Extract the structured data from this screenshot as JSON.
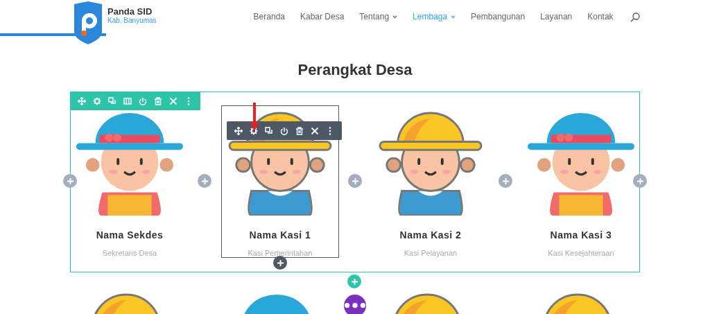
{
  "site": {
    "name": "Panda SID",
    "region": "Kab. Banyumas"
  },
  "nav": [
    {
      "label": "Beranda",
      "selected": false,
      "dropdown": false
    },
    {
      "label": "Kabar Desa",
      "selected": false,
      "dropdown": false
    },
    {
      "label": "Tentang",
      "selected": false,
      "dropdown": true
    },
    {
      "label": "Lembaga",
      "selected": true,
      "dropdown": true
    },
    {
      "label": "Pembangunan",
      "selected": false,
      "dropdown": false
    },
    {
      "label": "Layanan",
      "selected": false,
      "dropdown": false
    },
    {
      "label": "Kontak",
      "selected": false,
      "dropdown": false
    }
  ],
  "heading": "Perangkat Desa",
  "row_toolbar": [
    {
      "kind": "move"
    },
    {
      "kind": "settings"
    },
    {
      "kind": "duplicate"
    },
    {
      "kind": "columns"
    },
    {
      "kind": "save"
    },
    {
      "kind": "delete"
    },
    {
      "kind": "close"
    },
    {
      "kind": "more"
    }
  ],
  "module_toolbar": [
    {
      "kind": "move"
    },
    {
      "kind": "settings"
    },
    {
      "kind": "duplicate"
    },
    {
      "kind": "save"
    },
    {
      "kind": "delete"
    },
    {
      "kind": "close"
    },
    {
      "kind": "more"
    }
  ],
  "members": [
    {
      "name": "Nama Sekdes",
      "role": "Sekretaris Desa",
      "kind": "girl",
      "selected": false
    },
    {
      "name": "Nama Kasi 1",
      "role": "Kasi Pemerintahan",
      "kind": "boy",
      "selected": true
    },
    {
      "name": "Nama Kasi 2",
      "role": "Kasi Pelayanan",
      "kind": "boy",
      "selected": false
    },
    {
      "name": "Nama Kasi 3",
      "role": "Kasi Kesejahteraan",
      "kind": "girl",
      "selected": false
    }
  ],
  "next_row": [
    {
      "kind": "boy"
    },
    {
      "kind": "girl"
    },
    {
      "kind": "boy"
    },
    {
      "kind": "boy"
    }
  ]
}
